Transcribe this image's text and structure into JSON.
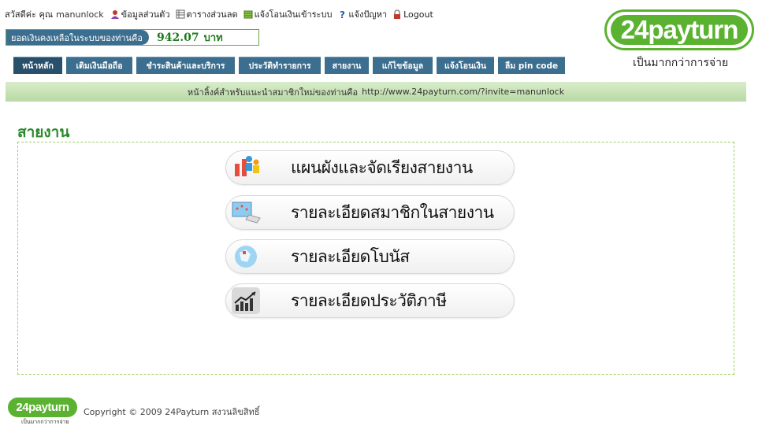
{
  "top": {
    "greeting": "สวัสดีค่ะ คุณ",
    "username": "manunlock",
    "links": [
      {
        "label": "ข้อมูลส่วนตัว",
        "icon": "user-icon"
      },
      {
        "label": "ตารางส่วนลด",
        "icon": "table-icon"
      },
      {
        "label": "แจ้งโอนเงินเข้าระบบ",
        "icon": "money-stack-icon"
      },
      {
        "label": "แจ้งปัญหา",
        "icon": "help-icon"
      },
      {
        "label": "Logout",
        "icon": "lock-icon"
      }
    ]
  },
  "balance": {
    "label": "ยอดเงินคงเหลือในระบบของท่านคือ",
    "amount": "942.07",
    "currency": "บาท"
  },
  "logo": {
    "text": "24payturn",
    "slogan": "เป็นมากกว่าการจ่าย"
  },
  "nav": [
    {
      "label": "หน้าหลัก"
    },
    {
      "label": "เติมเงินมือถือ"
    },
    {
      "label": "ชำระสินค้าและบริการ"
    },
    {
      "label": "ประวัติทำรายการ"
    },
    {
      "label": "สายงาน"
    },
    {
      "label": "แก้ไขข้อมูล"
    },
    {
      "label": "แจ้งโอนเงิน"
    },
    {
      "label": "ลืม pin code"
    }
  ],
  "invite": {
    "text": "หน้าลิ้งค์สำหรับแนะนำสมาชิกใหม่ของท่านคือ",
    "url": "http://www.24payturn.com/?invite=manunlock"
  },
  "page_title": "สายงาน",
  "menu": [
    {
      "label": "แผนผังและจัดเรียงสายงาน",
      "icon": "people-chart-icon"
    },
    {
      "label": "รายละเอียดสมาชิกในสายงาน",
      "icon": "computer-icon"
    },
    {
      "label": "รายละเอียดโบนัส",
      "icon": "bonus-globe-icon"
    },
    {
      "label": "รายละเอียดประวัติภาษี",
      "icon": "growth-chart-icon"
    }
  ],
  "footer": {
    "logo_text": "24payturn",
    "logo_slogan": "เป็นมากกว่าการจ่าย",
    "copyright": "Copyright © 2009 24Payturn สงวนลิขสิทธิ์"
  },
  "colors": {
    "nav_blue": "#3c6e8f",
    "brand_green": "#5ab230",
    "title_green": "#2a8a2a"
  }
}
